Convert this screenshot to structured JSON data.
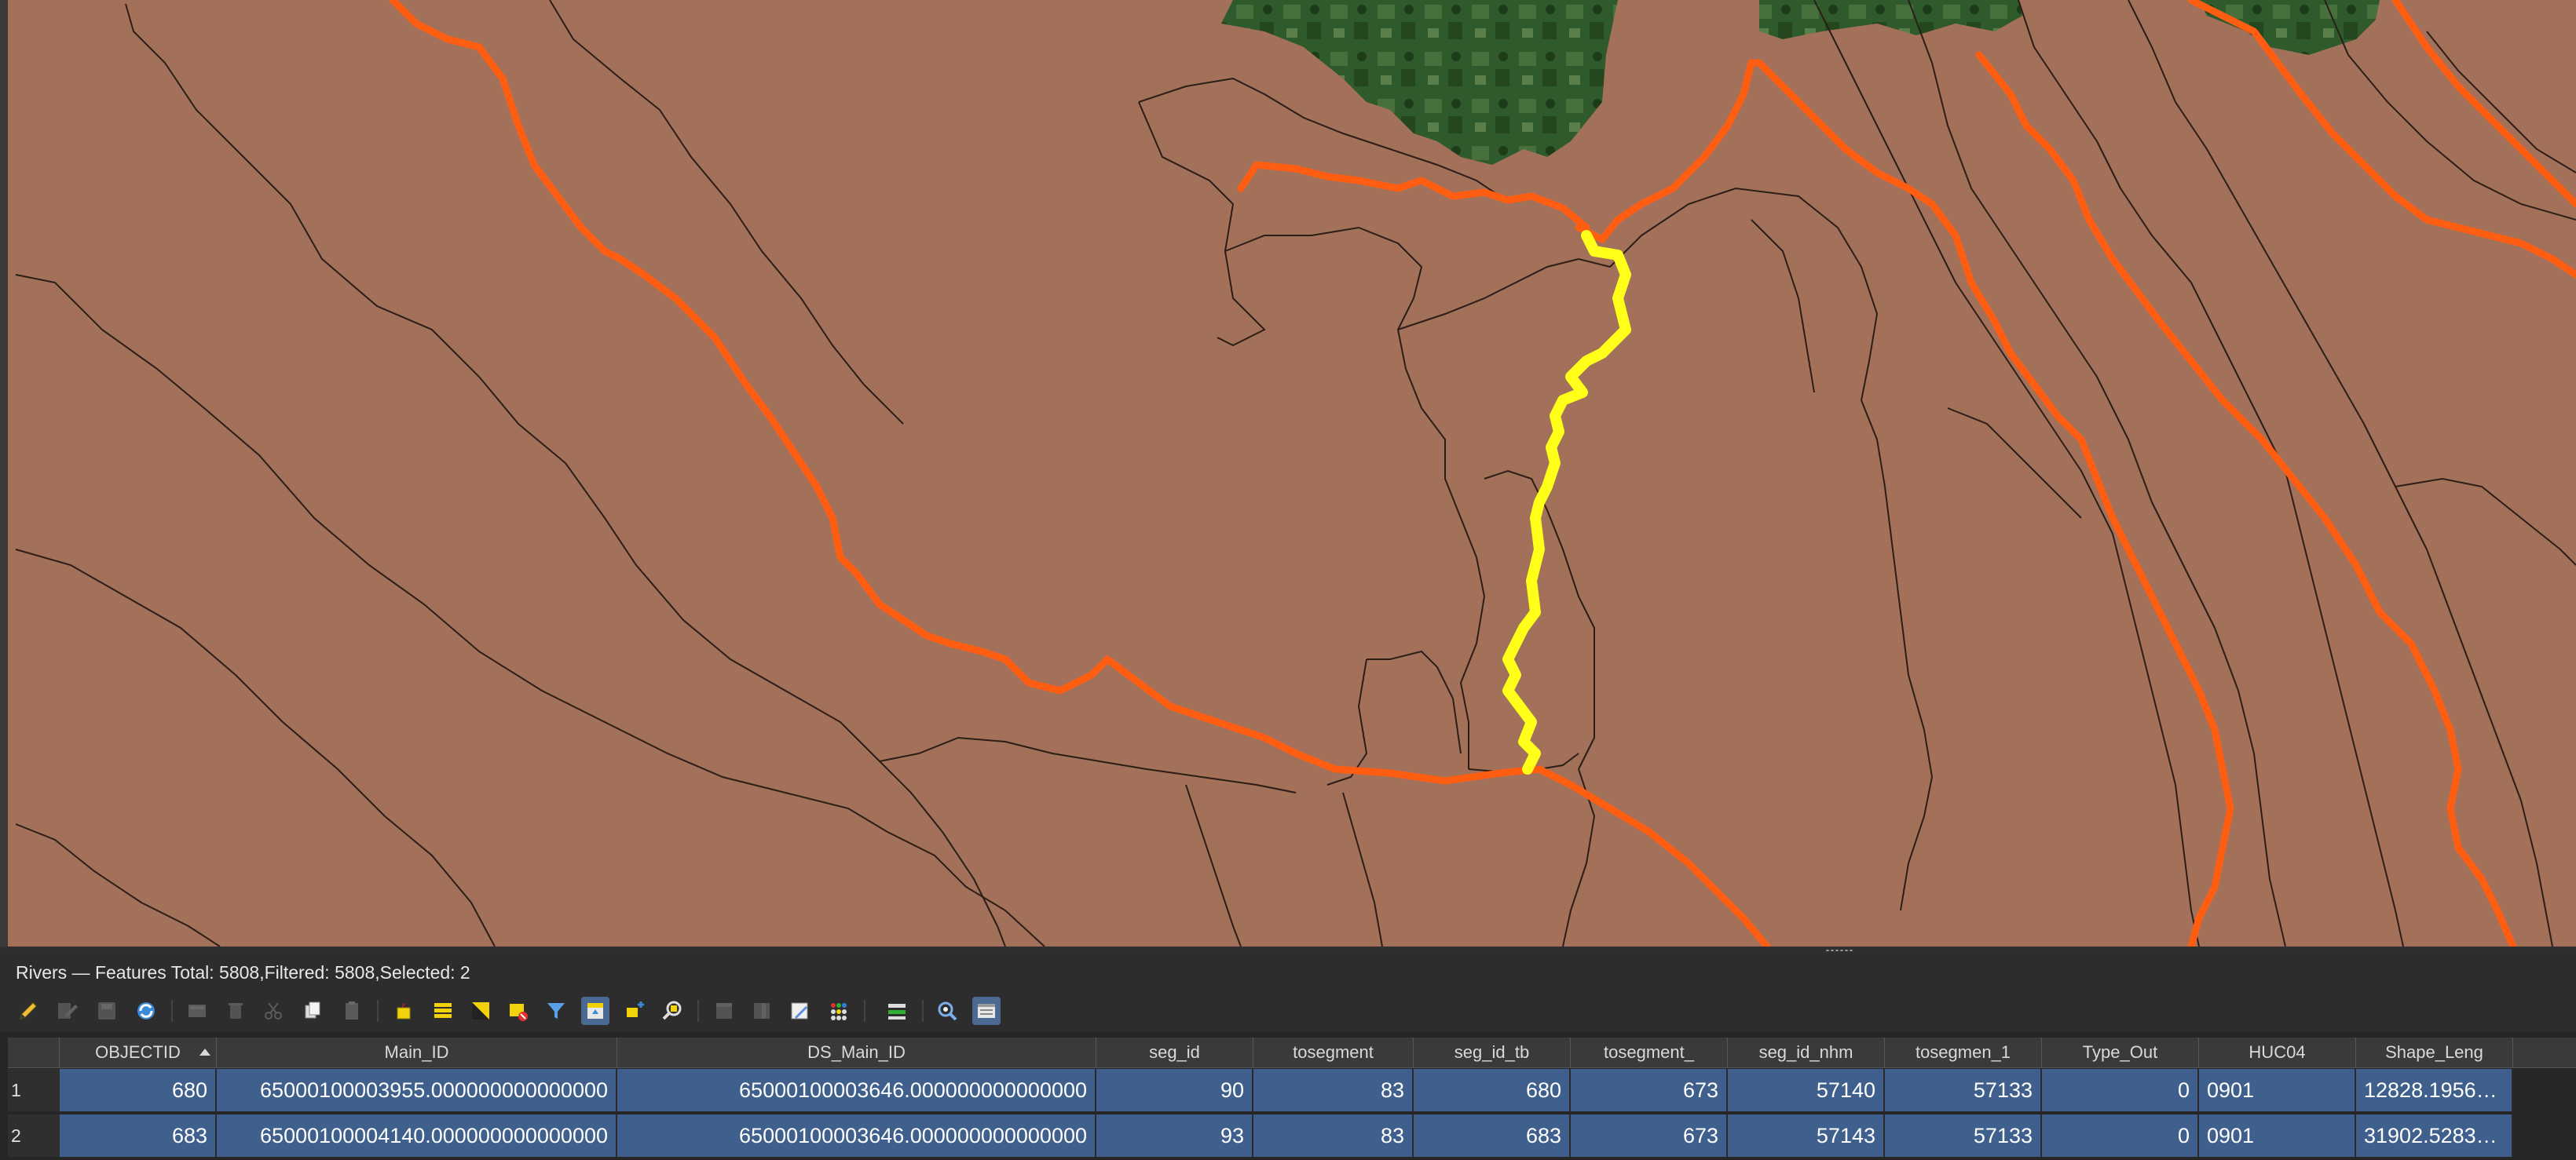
{
  "status": {
    "text": "Rivers — Features Total: 5808,Filtered: 5808,Selected: 2"
  },
  "colors": {
    "map_background": "#a3705a",
    "river": "#ff5e12",
    "selected_river": "#ffff1a",
    "boundary": "#2b1e16",
    "selected_row": "#3f5f8c"
  },
  "map": {
    "layers": [
      "imagery",
      "watershed-boundaries",
      "rivers",
      "selected-rivers"
    ],
    "selected_feature_count": 2
  },
  "toolbar": {
    "buttons": [
      {
        "name": "toggle-editing-icon",
        "state": "normal"
      },
      {
        "name": "multi-edit-icon",
        "state": "disabled"
      },
      {
        "name": "save-edits-icon",
        "state": "disabled"
      },
      {
        "name": "reload-table-icon",
        "state": "normal"
      },
      {
        "name": "add-feature-icon",
        "state": "disabled"
      },
      {
        "name": "delete-features-icon",
        "state": "disabled"
      },
      {
        "name": "cut-icon",
        "state": "disabled"
      },
      {
        "name": "copy-icon",
        "state": "normal"
      },
      {
        "name": "paste-icon",
        "state": "disabled"
      },
      {
        "name": "select-by-expression-icon",
        "state": "normal"
      },
      {
        "name": "select-all-icon",
        "state": "normal"
      },
      {
        "name": "invert-selection-icon",
        "state": "normal"
      },
      {
        "name": "deselect-all-icon",
        "state": "normal"
      },
      {
        "name": "filter-select-icon",
        "state": "normal"
      },
      {
        "name": "move-selection-to-top-icon",
        "state": "active"
      },
      {
        "name": "pan-to-selection-icon",
        "state": "normal"
      },
      {
        "name": "zoom-to-selection-icon",
        "state": "normal"
      },
      {
        "name": "new-field-icon",
        "state": "disabled"
      },
      {
        "name": "delete-field-icon",
        "state": "disabled"
      },
      {
        "name": "field-calculator-icon",
        "state": "normal"
      },
      {
        "name": "conditional-formatting-icon",
        "state": "normal"
      },
      {
        "name": "actions-icon",
        "state": "normal"
      },
      {
        "name": "dock-table-icon",
        "state": "normal"
      },
      {
        "name": "form-view-icon",
        "state": "normal"
      }
    ]
  },
  "table": {
    "columns": [
      "OBJECTID",
      "Main_ID",
      "DS_Main_ID",
      "seg_id",
      "tosegment",
      "seg_id_tb",
      "tosegment_",
      "seg_id_nhm",
      "tosegmen_1",
      "Type_Out",
      "HUC04",
      "Shape_Leng"
    ],
    "sorted_column": "OBJECTID",
    "sort_order": "ascending",
    "rows": [
      {
        "num": "1",
        "cells": [
          "680",
          "65000100003955.000000000000000",
          "65000100003646.000000000000000",
          "90",
          "83",
          "680",
          "673",
          "57140",
          "57133",
          "0",
          "0901",
          "12828.19565..."
        ]
      },
      {
        "num": "2",
        "cells": [
          "683",
          "65000100004140.000000000000000",
          "65000100003646.000000000000000",
          "93",
          "83",
          "683",
          "673",
          "57143",
          "57133",
          "0",
          "0901",
          "31902.52838..."
        ]
      }
    ]
  }
}
